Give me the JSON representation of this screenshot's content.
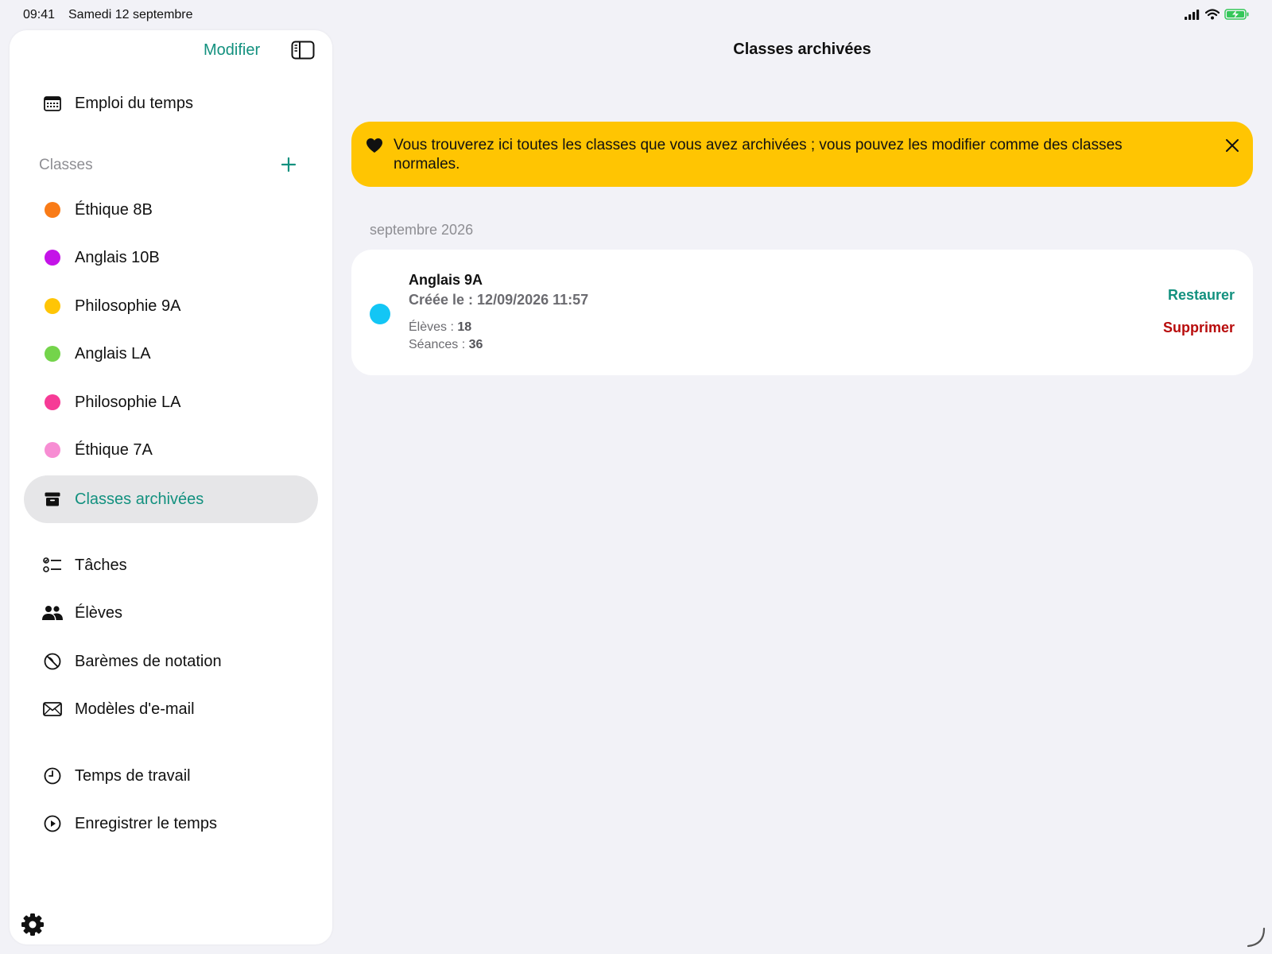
{
  "status_bar": {
    "time": "09:41",
    "date": "Samedi 12 septembre",
    "icons": [
      "cellular-signal-icon",
      "wifi-icon",
      "battery-charging-icon"
    ]
  },
  "sidebar": {
    "edit_label": "Modifier",
    "schedule": {
      "label": "Emploi du temps",
      "icon": "calendar-icon"
    },
    "classes_section": {
      "title": "Classes",
      "items": [
        {
          "label": "Éthique 8B",
          "color": "#f97b17"
        },
        {
          "label": "Anglais 10B",
          "color": "#c413e8"
        },
        {
          "label": "Philosophie 9A",
          "color": "#ffc506"
        },
        {
          "label": "Anglais LA",
          "color": "#74d44b"
        },
        {
          "label": "Philosophie LA",
          "color": "#f63b96"
        },
        {
          "label": "Éthique 7A",
          "color": "#f78dd3"
        }
      ],
      "archived": {
        "label": "Classes archivées",
        "icon": "archive-box-icon",
        "active": true
      }
    },
    "tools": [
      {
        "label": "Tâches",
        "icon": "checklist-icon"
      },
      {
        "label": "Élèves",
        "icon": "people-icon"
      },
      {
        "label": "Barèmes de notation",
        "icon": "grading-scale-icon"
      },
      {
        "label": "Modèles d'e-mail",
        "icon": "envelope-icon"
      }
    ],
    "time_tools": [
      {
        "label": "Temps de travail",
        "icon": "clock-icon"
      },
      {
        "label": "Enregistrer le temps",
        "icon": "play-circle-icon"
      }
    ]
  },
  "main": {
    "title": "Classes archivées",
    "banner": {
      "text": "Vous trouverez ici toutes les classes que vous avez archivées ; vous pouvez les modifier comme des classes normales.",
      "bg_color": "#ffc502"
    },
    "groups": [
      {
        "header": "septembre 2026",
        "cards": [
          {
            "name": "Anglais 9A",
            "created": "Créée le : 12/09/2026 11:57",
            "students_label": "Élèves :",
            "students_value": "18",
            "sessions_label": "Séances :",
            "sessions_value": "36",
            "color": "#13c6f5",
            "restore_label": "Restaurer",
            "delete_label": "Supprimer"
          }
        ]
      }
    ]
  },
  "colors": {
    "accent": "#13917f",
    "danger": "#b80c0c",
    "background": "#f2f2f7"
  }
}
